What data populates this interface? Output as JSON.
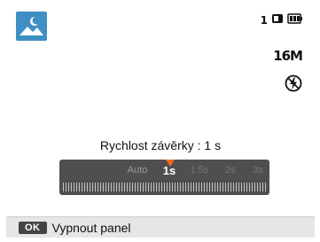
{
  "status": {
    "shots_remaining": "1",
    "resolution": "16M"
  },
  "caption": "Rychlost závěrky : 1 s",
  "shutter": {
    "values": [
      "Auto",
      "1s",
      "1.5s",
      "2s",
      "3s"
    ],
    "selected": "1s"
  },
  "bottom_bar": {
    "ok_label": "OK",
    "action_label": "Vypnout panel"
  },
  "colors": {
    "accent": "#f26b21",
    "panel": "#4f4f4f",
    "scene_icon": "#3f8fc4"
  }
}
